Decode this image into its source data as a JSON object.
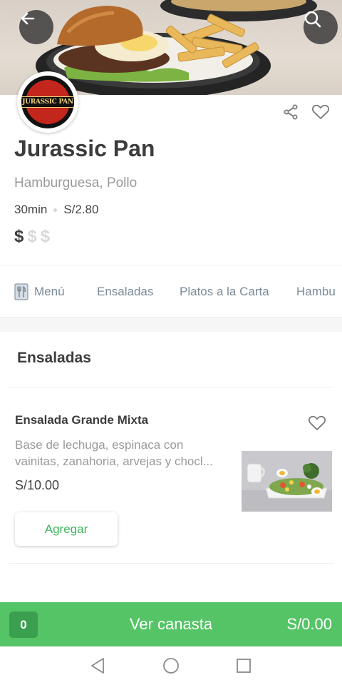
{
  "restaurant": {
    "name": "Jurassic Pan",
    "logo_text": "JURASSIC PAN",
    "categories": "Hamburguesa, Pollo",
    "delivery_time": "30min",
    "delivery_fee": "S/2.80",
    "price_level": {
      "symbols": [
        "$",
        "$",
        "$"
      ],
      "active": 1
    }
  },
  "tabs": [
    {
      "label": "Menú",
      "icon": "menu-book-icon"
    },
    {
      "label": "Ensaladas"
    },
    {
      "label": "Platos a la Carta"
    },
    {
      "label": "Hambu"
    }
  ],
  "section": {
    "title": "Ensaladas",
    "items": [
      {
        "name": "Ensalada Grande Mixta",
        "description": "Base de lechuga, espinaca con vainitas, zanahoria, arvejas y chocl...",
        "price": "S/10.00",
        "add_label": "Agregar"
      }
    ]
  },
  "cart": {
    "count": "0",
    "label": "Ver canasta",
    "total": "S/0.00"
  },
  "icons": {
    "back": "arrow-left-icon",
    "search": "search-icon",
    "share": "share-icon",
    "favorite": "heart-outline-icon"
  },
  "colors": {
    "accent_green": "#54c466",
    "accent_green_dark": "#3aa04f",
    "button_text_green": "#3cb55a",
    "tab_text": "#7a8a9a"
  }
}
